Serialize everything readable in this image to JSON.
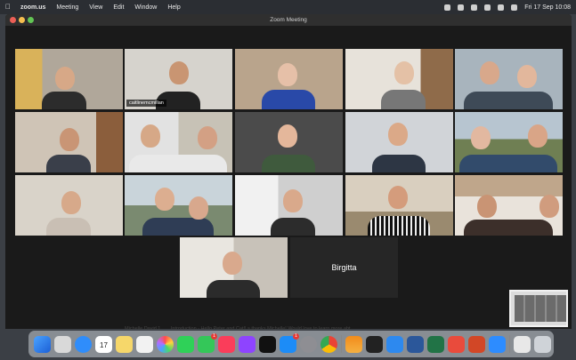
{
  "menubar": {
    "app": "zoom.us",
    "items": [
      "Meeting",
      "View",
      "Edit",
      "Window",
      "Help"
    ],
    "clock": "Fri 17 Sep  10:08"
  },
  "window": {
    "title": "Zoom Meeting"
  },
  "participants": {
    "active_name": "caitlinemcmillan",
    "name_only_tile": "Birgitta"
  },
  "chat_preview": {
    "sender": "Michelle   David 1",
    "text": "Introduction - Hello Peter and Cat!! s  thanks Michelle! Would love to learn more abt"
  },
  "dock": {
    "calendar_day": "17",
    "badges": {
      "messages": "1",
      "appstore": "1"
    }
  },
  "colors": {
    "active_speaker": "#c6e24d",
    "close": "#ec5f56",
    "minimize": "#f5be4f",
    "maximize": "#62c554"
  }
}
